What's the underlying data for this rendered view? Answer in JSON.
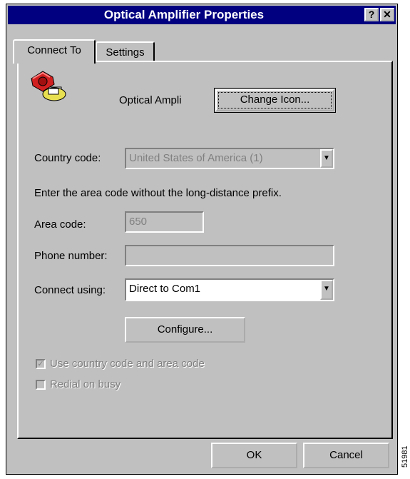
{
  "window": {
    "title": "Optical Amplifier Properties",
    "help_label": "?",
    "close_label": "✕"
  },
  "tabs": [
    {
      "label": "Connect To"
    },
    {
      "label": "Settings"
    }
  ],
  "connection": {
    "icon": "phone-icon",
    "name": "Optical Ampli",
    "change_icon_label": "Change Icon..."
  },
  "form": {
    "country_label": "Country code:",
    "country_value": "United States of America (1)",
    "instructions": "Enter the area code without the long-distance prefix.",
    "area_label": "Area code:",
    "area_value": "650",
    "phone_label": "Phone number:",
    "phone_value": "",
    "connect_label": "Connect using:",
    "connect_value": "Direct to Com1",
    "configure_label": "Configure..."
  },
  "options": {
    "use_codes_label": "Use country code and area code",
    "use_codes_checked": true,
    "redial_label": "Redial on busy",
    "redial_checked": false
  },
  "footer": {
    "ok_label": "OK",
    "cancel_label": "Cancel"
  },
  "side_caption": "51981",
  "colors": {
    "titlebar": "#000080",
    "face": "#c0c0c0"
  }
}
